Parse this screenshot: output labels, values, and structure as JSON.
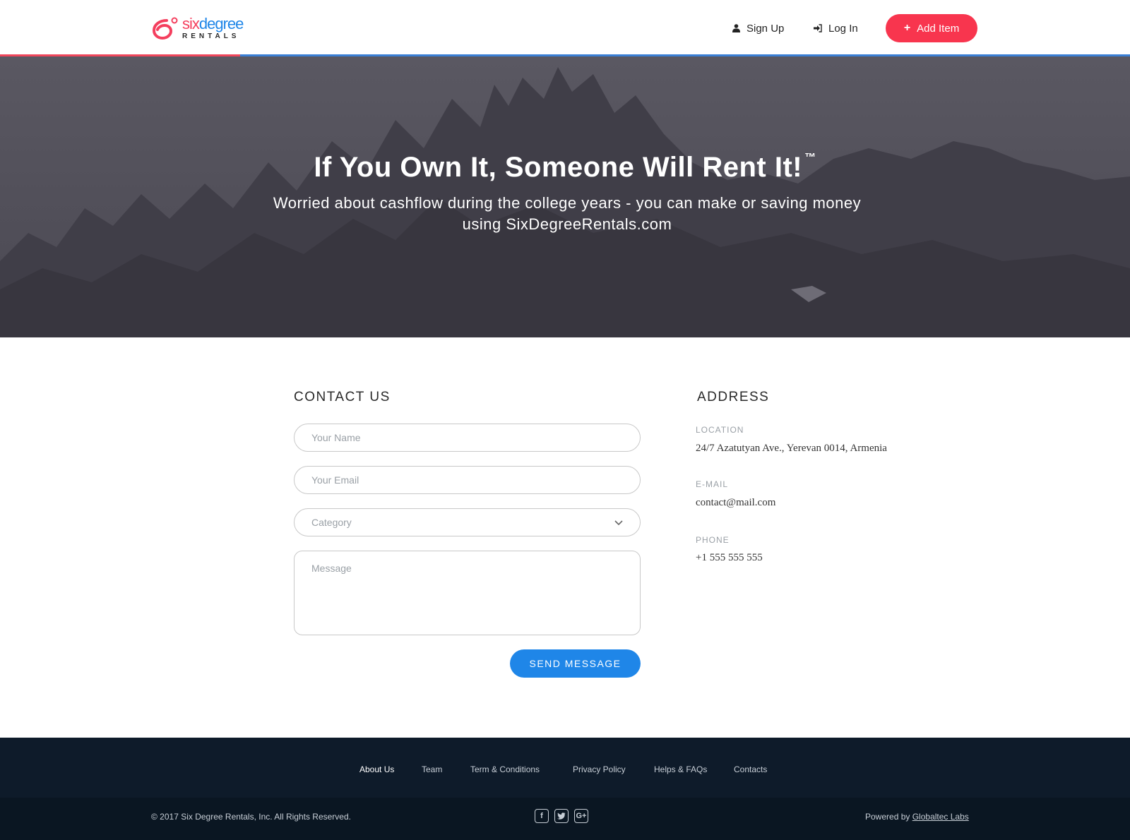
{
  "brand": {
    "six": "six",
    "degree": "degree",
    "rentals": "RENTALS"
  },
  "nav": {
    "signup": "Sign Up",
    "login": "Log In",
    "add_item": "Add Item"
  },
  "hero": {
    "title": "If You Own It, Someone Will Rent It!",
    "trademark": "™",
    "subtitle": "Worried about cashflow during the college years - you can make or saving money using SixDegreeRentals.com"
  },
  "contact": {
    "title": "CONTACT US",
    "name_placeholder": "Your Name",
    "email_placeholder": "Your Email",
    "category_placeholder": "Category",
    "message_placeholder": "Message",
    "send_label": "SEND MESSAGE"
  },
  "address": {
    "title": "ADDRESS",
    "location_label": "LOCATION",
    "location_value": "24/7 Azatutyan Ave., Yerevan 0014, Armenia",
    "email_label": "E-MAIL",
    "email_value": "contact@mail.com",
    "phone_label": "PHONE",
    "phone_value": "+1 555 555 555"
  },
  "footer": {
    "links": [
      "About Us",
      "Team",
      "Term & Conditions",
      "Privacy Policy",
      "Helps & FAQs",
      "Contacts"
    ],
    "active_link": "About Us",
    "copyright": "© 2017  Six Degree Rentals, Inc. All Rights Reserved.",
    "social": [
      "facebook-icon",
      "twitter-icon",
      "google-plus-icon"
    ],
    "powered_prefix": "Powered by",
    "powered_link": "Globaltec Labs"
  },
  "colors": {
    "brand_red": "#f8354e",
    "brand_blue": "#1f86e8",
    "footer_bg": "#0e1b2a"
  }
}
